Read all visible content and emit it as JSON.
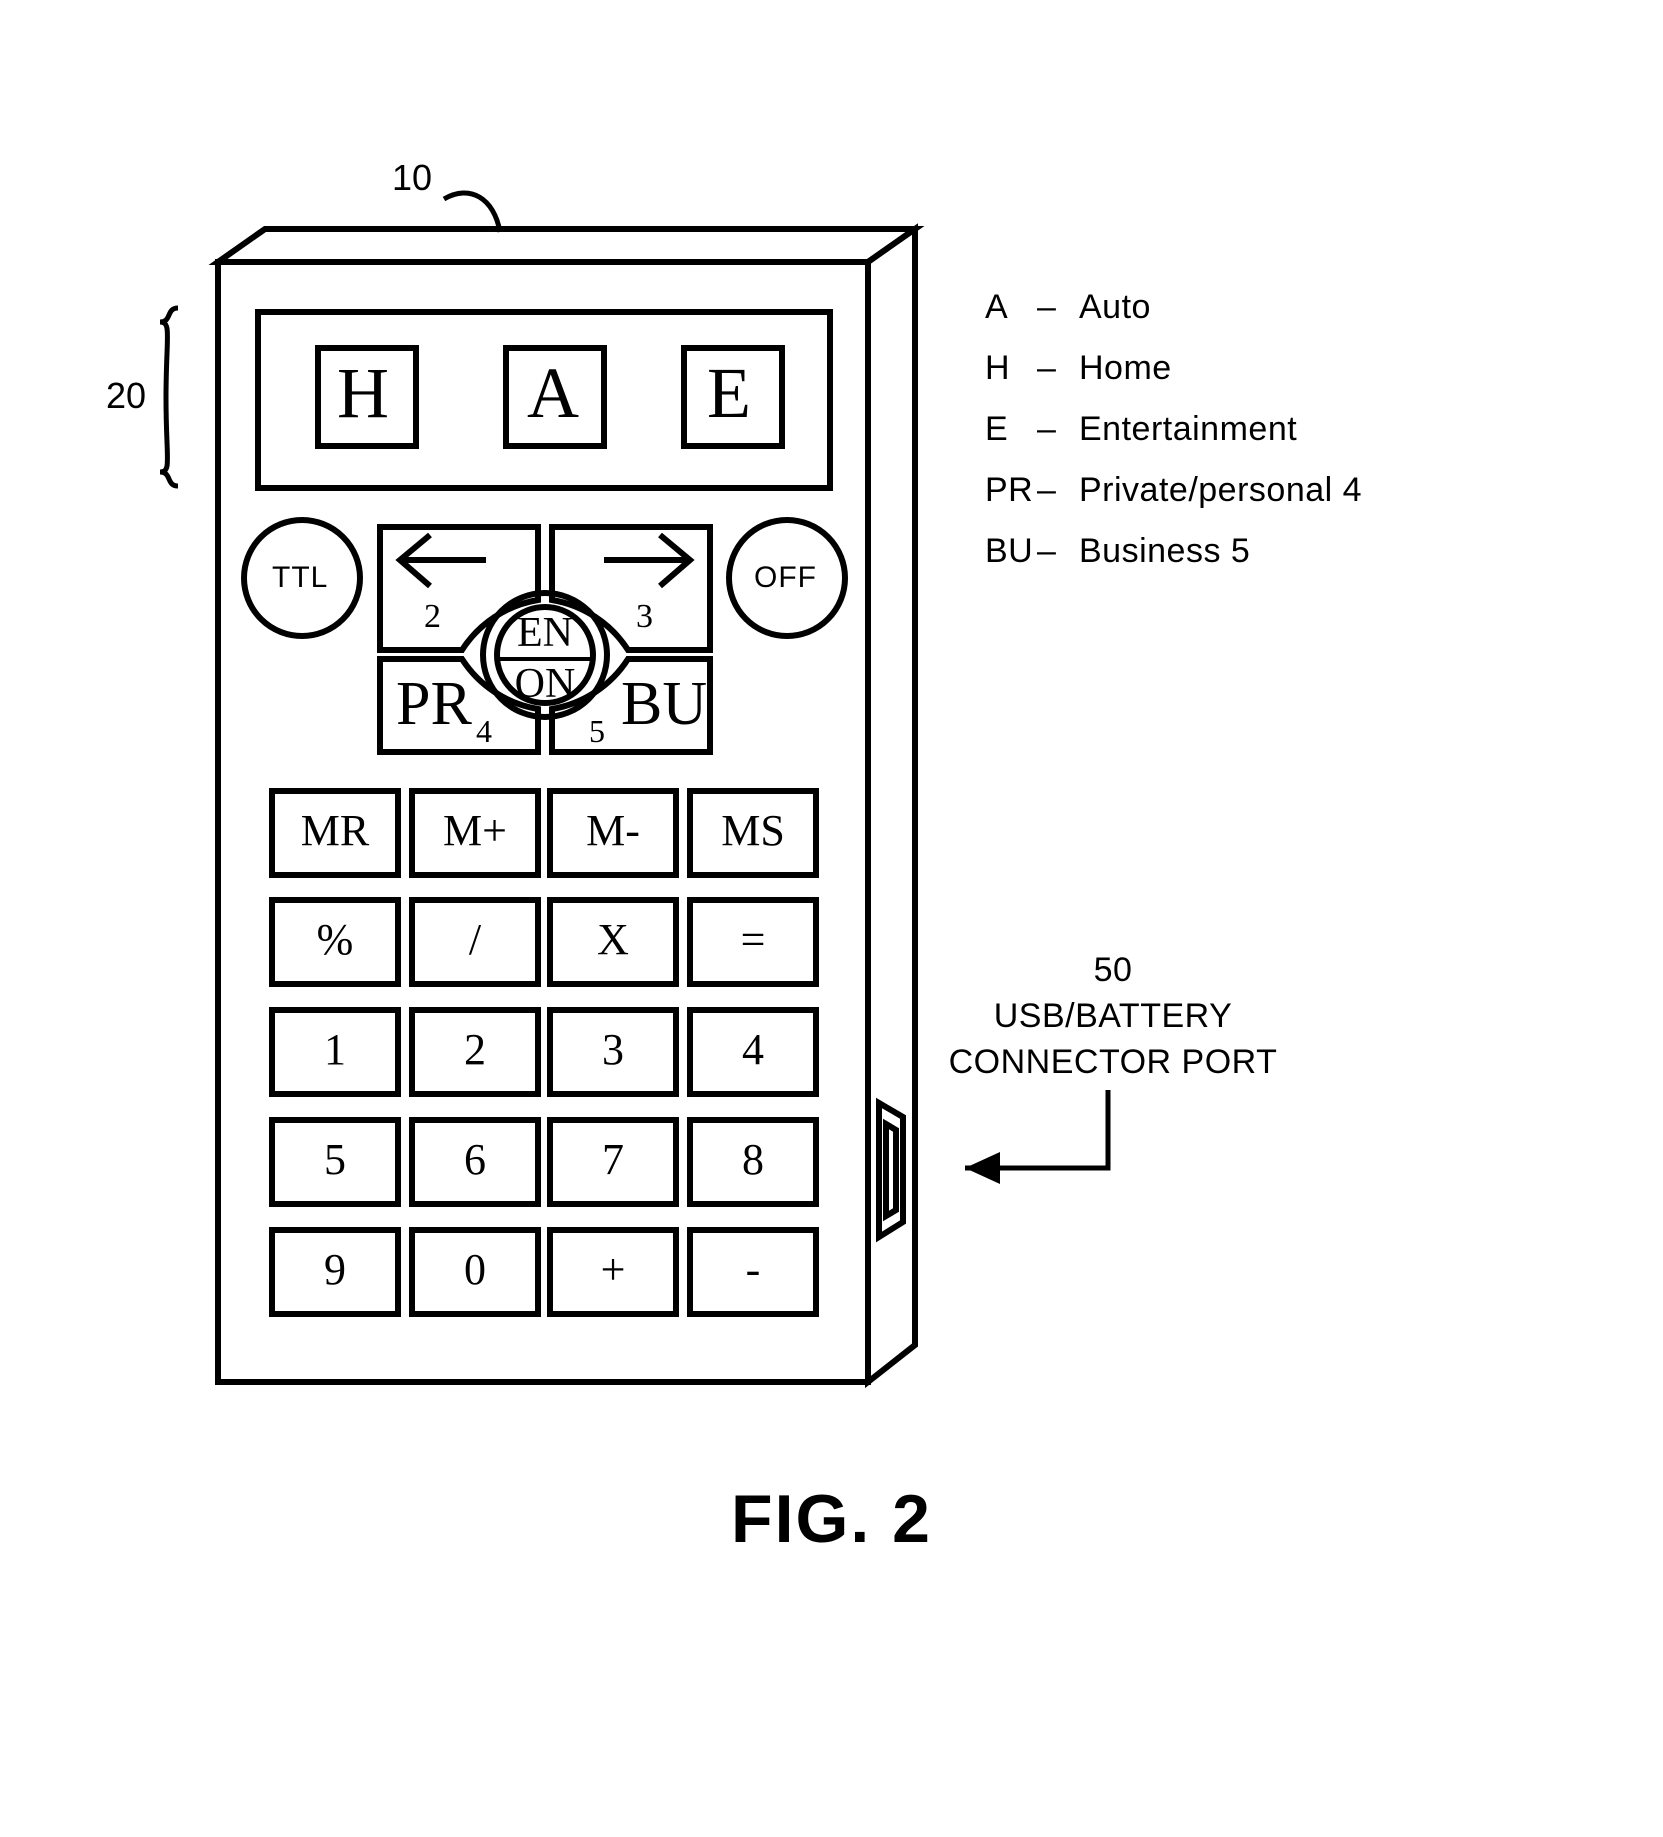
{
  "figure": {
    "title": "FIG. 2",
    "device_ref": "10",
    "display_ref": "20",
    "port_ref": "50",
    "port_label_line1": "USB/BATTERY",
    "port_label_line2": "CONNECTOR PORT"
  },
  "display": {
    "letters": [
      "H",
      "A",
      "E"
    ]
  },
  "controls": {
    "ttl": "TTL",
    "off": "OFF",
    "left_arrow": "←",
    "right_arrow": "→",
    "left_num": "2",
    "right_num": "3",
    "center_top": "EN",
    "center_bottom": "ON",
    "pr": "PR",
    "pr_num": "4",
    "bu": "BU",
    "bu_num": "5"
  },
  "keypad": {
    "rows": [
      [
        "MR",
        "M+",
        "M-",
        "MS"
      ],
      [
        "%",
        "/",
        "X",
        "="
      ],
      [
        "1",
        "2",
        "3",
        "4"
      ],
      [
        "5",
        "6",
        "7",
        "8"
      ],
      [
        "9",
        "0",
        "+",
        "-"
      ]
    ]
  },
  "legend": {
    "items": [
      {
        "code": "A",
        "dash": "–",
        "text": "Auto"
      },
      {
        "code": "H",
        "dash": "–",
        "text": "Home"
      },
      {
        "code": "E",
        "dash": "–",
        "text": "Entertainment"
      },
      {
        "code": "PR",
        "dash": "–",
        "text": "Private/personal  4"
      },
      {
        "code": "BU",
        "dash": "–",
        "text": "Business  5"
      }
    ]
  },
  "colors": {
    "line": "#000000",
    "background": "#ffffff"
  }
}
